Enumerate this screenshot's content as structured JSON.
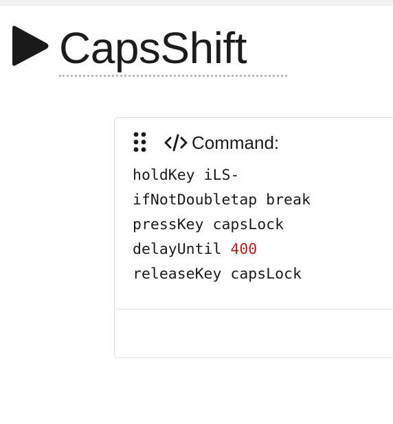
{
  "page": {
    "title": "CapsShift"
  },
  "icons": {
    "play": "play-icon",
    "drag": "drag-handle-icon",
    "code": "code-icon"
  },
  "card": {
    "label": "Command:",
    "code_lines": [
      {
        "text": "holdKey iLS-"
      },
      {
        "text": "ifNotDoubletap break"
      },
      {
        "text": "pressKey capsLock"
      },
      {
        "prefix": "delayUntil ",
        "number": "400"
      },
      {
        "text": "releaseKey capsLock"
      }
    ]
  },
  "colors": {
    "text": "#1c1c1c",
    "number": "#a8231e",
    "border": "#dedede",
    "underline": "#b9b9b9"
  }
}
